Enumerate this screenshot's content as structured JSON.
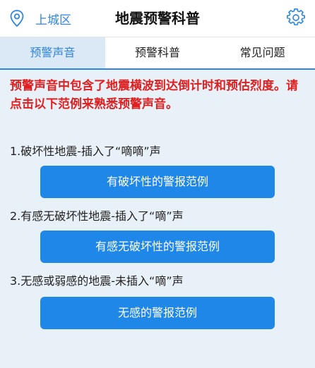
{
  "header": {
    "location_icon": "location-pin-icon",
    "location": "上城区",
    "title": "地震预警科普",
    "settings_icon": "gear-icon"
  },
  "tabs": [
    {
      "label": "预警声音",
      "active": true
    },
    {
      "label": "预警科普",
      "active": false
    },
    {
      "label": "常见问题",
      "active": false
    }
  ],
  "intro": "预警声音中包含了地震横波到达倒计时和预估烈度。请点击以下范例来熟悉预警声音。",
  "sections": [
    {
      "label": "1.破坏性地震-插入了“嘀嘀”声",
      "button": "有破坏性的警报范例"
    },
    {
      "label": "2.有感无破坏性地震-插入了“嘀”声",
      "button": "有感无破坏性的警报范例"
    },
    {
      "label": "3.无感或弱感的地震-未插入“嘀”声",
      "button": "无感的警报范例"
    }
  ],
  "colors": {
    "accent": "#2f86e0",
    "button": "#1e87e8",
    "warning_text": "#e02020",
    "background": "#e8f0f8"
  }
}
